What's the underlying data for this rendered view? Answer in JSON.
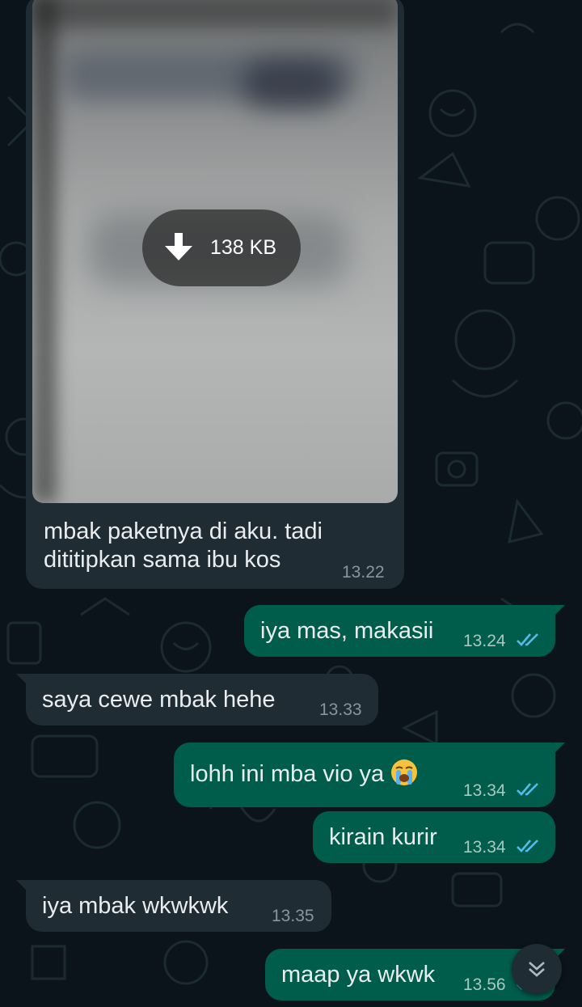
{
  "colors": {
    "background": "#0b141a",
    "incoming_bubble": "#202c33",
    "outgoing_bubble": "#005c4b",
    "read_ticks": "#53bdeb",
    "timestamp": "#8696a0"
  },
  "image_message": {
    "download_icon": "download-arrow-icon",
    "file_size": "138 KB",
    "caption_line1": "mbak paketnya di aku. tadi",
    "caption_line2": "dititipkan sama ibu kos",
    "time": "13.22"
  },
  "messages": [
    {
      "direction": "outgoing",
      "text": "iya mas, makasii",
      "time": "13.24",
      "status": "read-double-tick-icon"
    },
    {
      "direction": "incoming",
      "text": "saya cewe mbak hehe",
      "time": "13.33"
    },
    {
      "direction": "outgoing",
      "text": "lohh ini mba vio ya",
      "emoji": "loudly-crying-face-emoji",
      "time": "13.34",
      "status": "read-double-tick-icon"
    },
    {
      "direction": "outgoing",
      "text": "kirain kurir",
      "time": "13.34",
      "status": "read-double-tick-icon"
    },
    {
      "direction": "incoming",
      "text": "iya mbak wkwkwk",
      "time": "13.35"
    },
    {
      "direction": "outgoing",
      "text": "maap ya wkwk",
      "time": "13.56",
      "status": "read-double-tick-icon"
    }
  ],
  "scroll_button": {
    "icon": "double-chevron-down-icon"
  }
}
